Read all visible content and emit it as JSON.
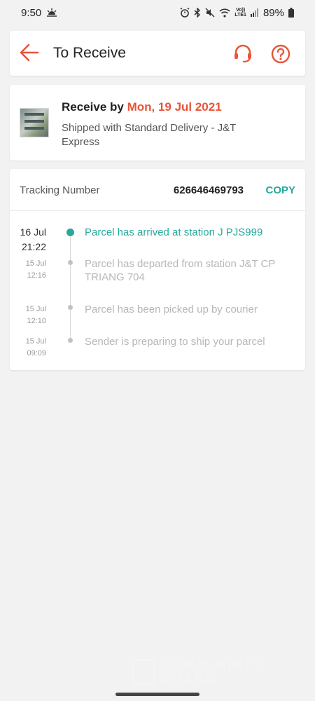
{
  "status_bar": {
    "time": "9:50",
    "battery": "89%",
    "lte_top": "Vo))",
    "lte_bottom": "LTE1"
  },
  "header": {
    "title": "To Receive",
    "accent_color": "#e8553a",
    "icons": [
      "back-arrow-icon",
      "headset-icon",
      "help-icon"
    ]
  },
  "delivery": {
    "receive_prefix": "Receive by ",
    "receive_date": "Mon, 19 Jul 2021",
    "shipping_text": "Shipped with Standard Delivery  - J&T Express"
  },
  "tracking": {
    "label": "Tracking Number",
    "number": "626646469793",
    "copy_label": "COPY",
    "copy_color": "#26aa99",
    "events": [
      {
        "date": "16 Jul",
        "time": "21:22",
        "text": "Parcel has arrived at station J PJS999"
      },
      {
        "date": "15 Jul",
        "time": "12:16",
        "text": "Parcel has departed from station J&T CP TRIANG 704"
      },
      {
        "date": "15 Jul",
        "time": "12:10",
        "text": "Parcel has been picked up by courier"
      },
      {
        "date": "15 Jul",
        "time": "09:09",
        "text": "Sender is preparing to ship your parcel"
      }
    ]
  },
  "watermark": {
    "line1": "COMPLAINTS",
    "line2": "BOARD"
  }
}
